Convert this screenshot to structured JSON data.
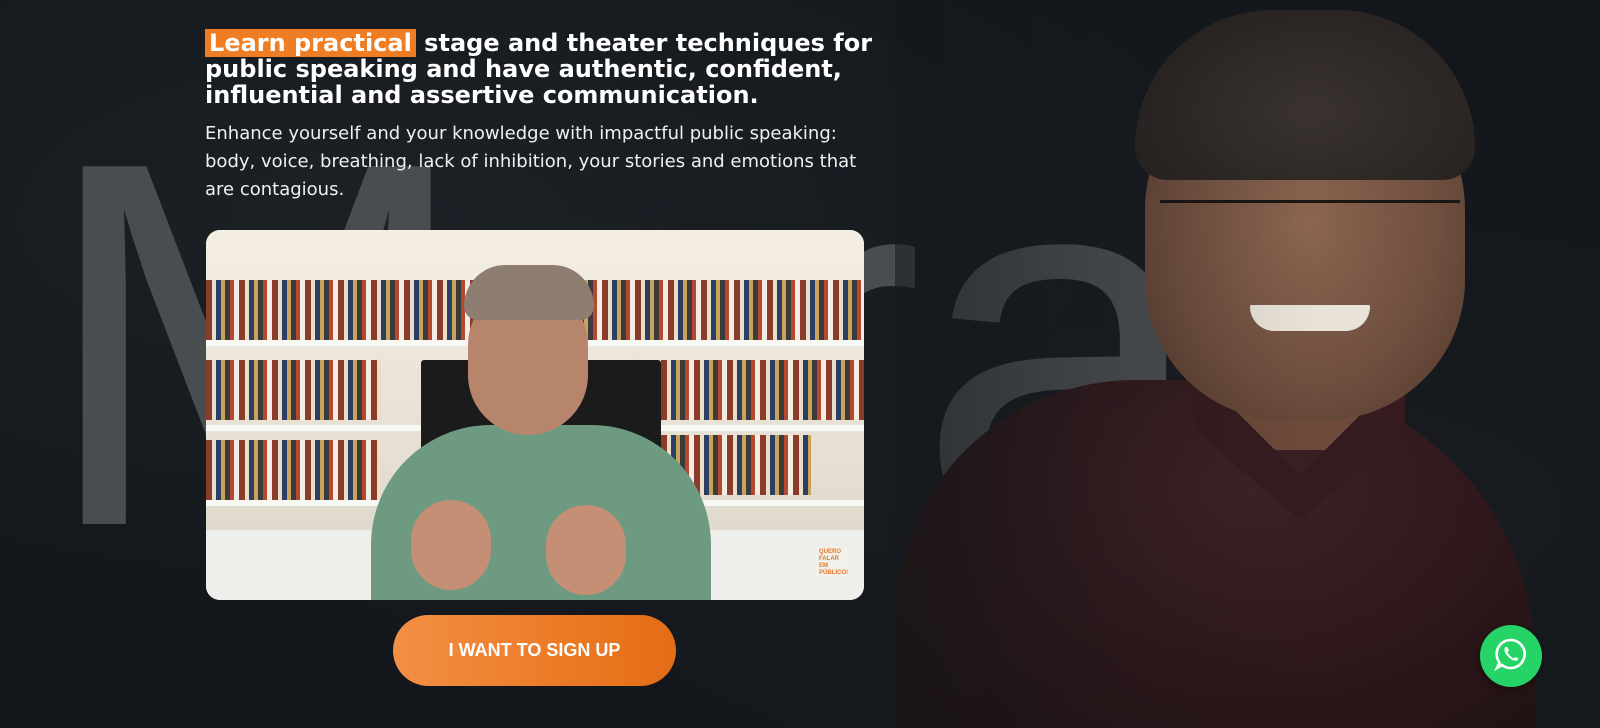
{
  "background": {
    "name_text": "Murai"
  },
  "hero": {
    "headline_highlight": "Learn practical",
    "headline_rest": " stage and theater techniques for public speaking and have authentic, confident, influential and assertive communication.",
    "subtext": "Enhance yourself and your knowledge with impactful public speaking: body, voice, breathing, lack of inhibition, your stories and emotions that are contagious."
  },
  "video": {
    "badge_text": "QUERO FALAR EM PÚBLICO!"
  },
  "cta": {
    "signup_label": "I WANT TO SIGN UP"
  },
  "colors": {
    "accent": "#ee7d24",
    "background": "#13171b",
    "whatsapp": "#25d366"
  },
  "icons": {
    "chat": "whatsapp-icon"
  }
}
